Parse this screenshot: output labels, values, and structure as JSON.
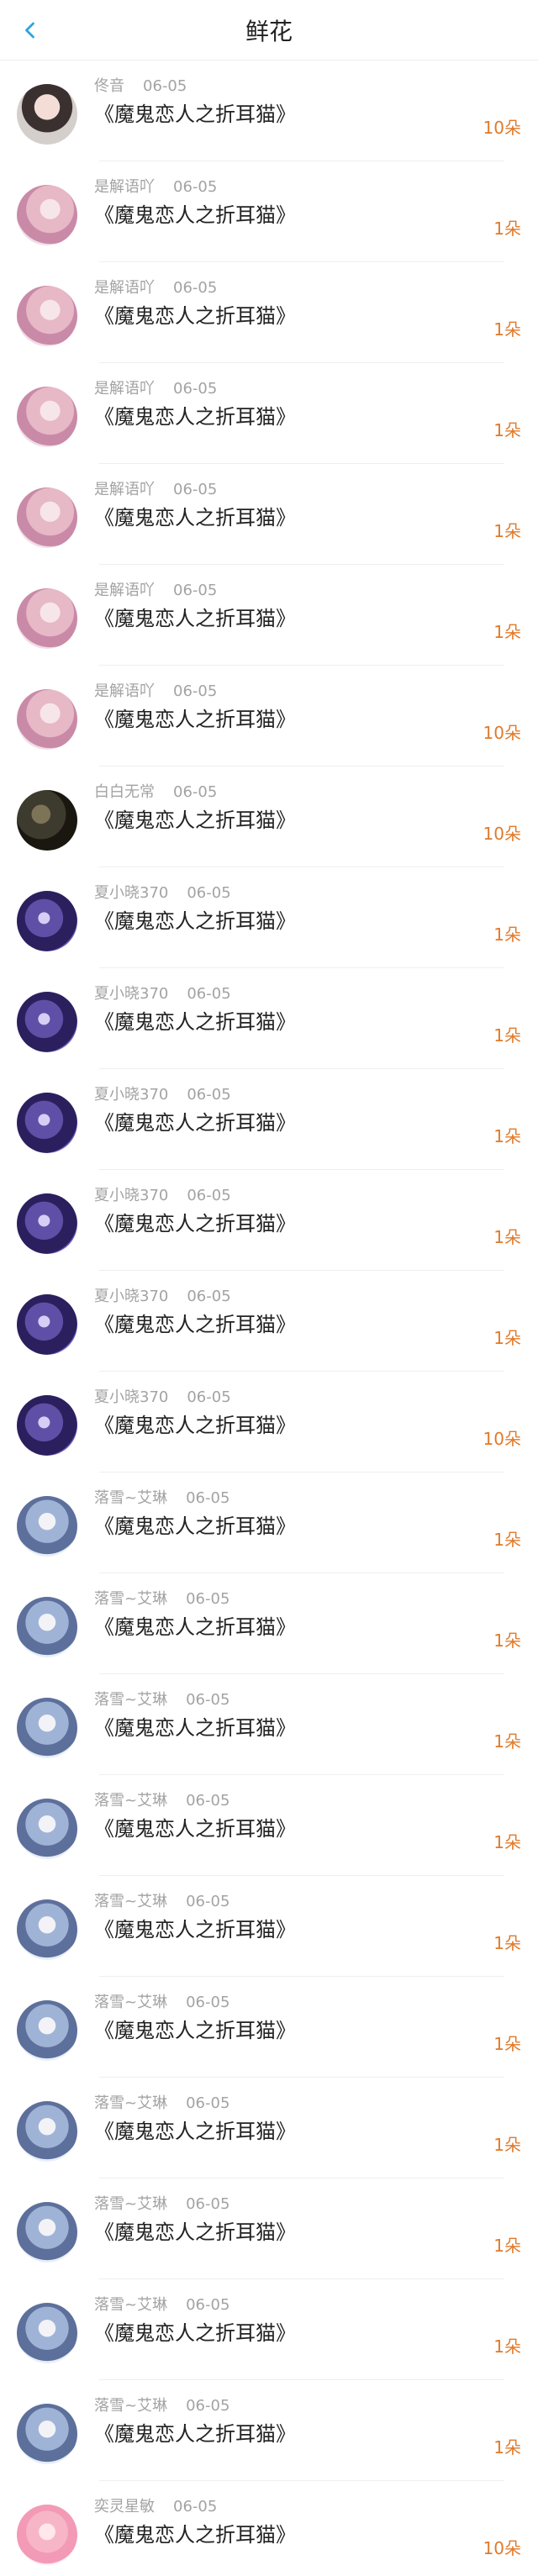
{
  "header": {
    "title": "鲜花"
  },
  "icons": {
    "back": "chevron-left-icon"
  },
  "colors": {
    "amount": "#e07a2b",
    "meta": "#a3a3a3",
    "back": "#2aa5e5"
  },
  "entries": [
    {
      "user": "佟音",
      "date": "06-05",
      "book": "《魔鬼恋人之折耳猫》",
      "amount": "10朵",
      "avatar_style": "av-a"
    },
    {
      "user": "是解语吖",
      "date": "06-05",
      "book": "《魔鬼恋人之折耳猫》",
      "amount": "1朵",
      "avatar_style": "av-b"
    },
    {
      "user": "是解语吖",
      "date": "06-05",
      "book": "《魔鬼恋人之折耳猫》",
      "amount": "1朵",
      "avatar_style": "av-b"
    },
    {
      "user": "是解语吖",
      "date": "06-05",
      "book": "《魔鬼恋人之折耳猫》",
      "amount": "1朵",
      "avatar_style": "av-b"
    },
    {
      "user": "是解语吖",
      "date": "06-05",
      "book": "《魔鬼恋人之折耳猫》",
      "amount": "1朵",
      "avatar_style": "av-b"
    },
    {
      "user": "是解语吖",
      "date": "06-05",
      "book": "《魔鬼恋人之折耳猫》",
      "amount": "1朵",
      "avatar_style": "av-b"
    },
    {
      "user": "是解语吖",
      "date": "06-05",
      "book": "《魔鬼恋人之折耳猫》",
      "amount": "10朵",
      "avatar_style": "av-b"
    },
    {
      "user": "白白无常",
      "date": "06-05",
      "book": "《魔鬼恋人之折耳猫》",
      "amount": "10朵",
      "avatar_style": "av-c"
    },
    {
      "user": "夏小晓370",
      "date": "06-05",
      "book": "《魔鬼恋人之折耳猫》",
      "amount": "1朵",
      "avatar_style": "av-d"
    },
    {
      "user": "夏小晓370",
      "date": "06-05",
      "book": "《魔鬼恋人之折耳猫》",
      "amount": "1朵",
      "avatar_style": "av-d"
    },
    {
      "user": "夏小晓370",
      "date": "06-05",
      "book": "《魔鬼恋人之折耳猫》",
      "amount": "1朵",
      "avatar_style": "av-d"
    },
    {
      "user": "夏小晓370",
      "date": "06-05",
      "book": "《魔鬼恋人之折耳猫》",
      "amount": "1朵",
      "avatar_style": "av-d"
    },
    {
      "user": "夏小晓370",
      "date": "06-05",
      "book": "《魔鬼恋人之折耳猫》",
      "amount": "1朵",
      "avatar_style": "av-d"
    },
    {
      "user": "夏小晓370",
      "date": "06-05",
      "book": "《魔鬼恋人之折耳猫》",
      "amount": "10朵",
      "avatar_style": "av-d"
    },
    {
      "user": "落雪~艾琳",
      "date": "06-05",
      "book": "《魔鬼恋人之折耳猫》",
      "amount": "1朵",
      "avatar_style": "av-e"
    },
    {
      "user": "落雪~艾琳",
      "date": "06-05",
      "book": "《魔鬼恋人之折耳猫》",
      "amount": "1朵",
      "avatar_style": "av-e"
    },
    {
      "user": "落雪~艾琳",
      "date": "06-05",
      "book": "《魔鬼恋人之折耳猫》",
      "amount": "1朵",
      "avatar_style": "av-e"
    },
    {
      "user": "落雪~艾琳",
      "date": "06-05",
      "book": "《魔鬼恋人之折耳猫》",
      "amount": "1朵",
      "avatar_style": "av-e"
    },
    {
      "user": "落雪~艾琳",
      "date": "06-05",
      "book": "《魔鬼恋人之折耳猫》",
      "amount": "1朵",
      "avatar_style": "av-e"
    },
    {
      "user": "落雪~艾琳",
      "date": "06-05",
      "book": "《魔鬼恋人之折耳猫》",
      "amount": "1朵",
      "avatar_style": "av-e"
    },
    {
      "user": "落雪~艾琳",
      "date": "06-05",
      "book": "《魔鬼恋人之折耳猫》",
      "amount": "1朵",
      "avatar_style": "av-e"
    },
    {
      "user": "落雪~艾琳",
      "date": "06-05",
      "book": "《魔鬼恋人之折耳猫》",
      "amount": "1朵",
      "avatar_style": "av-e"
    },
    {
      "user": "落雪~艾琳",
      "date": "06-05",
      "book": "《魔鬼恋人之折耳猫》",
      "amount": "1朵",
      "avatar_style": "av-e"
    },
    {
      "user": "落雪~艾琳",
      "date": "06-05",
      "book": "《魔鬼恋人之折耳猫》",
      "amount": "1朵",
      "avatar_style": "av-e"
    },
    {
      "user": "奕灵星敏",
      "date": "06-05",
      "book": "《魔鬼恋人之折耳猫》",
      "amount": "10朵",
      "avatar_style": "av-f"
    }
  ]
}
